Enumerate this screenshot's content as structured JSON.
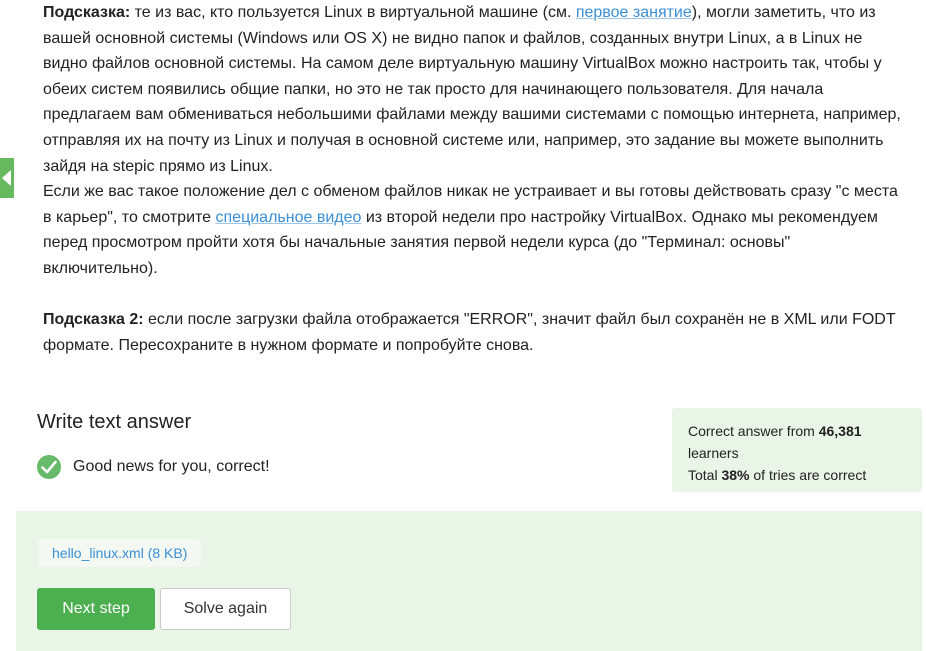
{
  "hint": {
    "label_1": "Подсказка:",
    "text_1a": " те из вас, кто пользуется Linux в виртуальной машине (см. ",
    "link_1": "первое занятие",
    "text_1b": "), могли заметить, что из вашей основной системы (Windows или OS X) не видно папок и файлов, созданных внутри Linux, а в Linux не видно файлов основной системы. На самом деле виртуальную машину VirtualBox можно настроить так, чтобы у обеих систем появились общие папки, но это не так просто для начинающего пользователя. Для начала предлагаем вам обмениваться небольшими файлами между вашими системами с помощью интернета, например, отправляя их на почту из Linux и получая в основной системе или, например, это задание вы можете выполнить зайдя на stepic прямо из Linux.",
    "text_2a": "Если же вас такое положение дел с обменом файлов никак не устраивает и вы готовы действовать сразу \"с места в карьер\", то смотрите ",
    "link_2": "специальное видео",
    "text_2b": " из второй недели про настройку VirtualBox. Однако мы рекомендуем перед просмотром пройти хотя бы начальные занятия первой недели курса (до \"Терминал: основы\" включительно).",
    "label_3": "Подсказка 2:",
    "text_3": " если после загрузки файла отображается \"ERROR\", значит файл был сохранён не в XML или FODT формате. Пересохраните в нужном формате и попробуйте снова."
  },
  "answer": {
    "title": "Write text answer",
    "status": "Good news for you, correct!"
  },
  "stats": {
    "line1_prefix": "Correct answer from ",
    "learners_count": "46,381",
    "line1_suffix": " learners",
    "line2_prefix": "Total ",
    "percent": "38%",
    "line2_suffix": " of tries are correct"
  },
  "submission": {
    "file": "hello_linux.xml (8 KB)",
    "next_label": "Next step",
    "again_label": "Solve again"
  },
  "colors": {
    "accent": "#4caf50",
    "success_bg": "#e9f5e6",
    "link": "#3a8fd6"
  }
}
